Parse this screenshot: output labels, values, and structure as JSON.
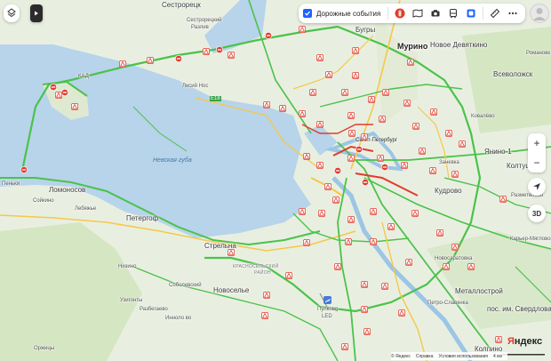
{
  "map": {
    "water_label": "Невская губа",
    "labels": {
      "sestroretsk": "Сестрорецк",
      "sestro_razliv": "Сестрорецкий",
      "razliv": "Разлив",
      "bugry": "Бугры",
      "murino": "Мурино",
      "novoe_devyatkino": "Новое Девяткино",
      "romanovka": "Романовк",
      "vsevolozhsk": "Всеволожск",
      "lisiy_nos": "Лисий Нос",
      "kovalevo": "Ковалёво",
      "yanino": "Янино-1",
      "koltushi": "Колтуш",
      "zanevka": "Заневка",
      "kudrovo": "Кудрово",
      "razmetelevo": "Разметелево",
      "karer": "Карьер-Мяглово",
      "lomonosov": "Ломоносов",
      "peterhof": "Петергоф",
      "strelna": "Стрельна",
      "penki": "Пеньки",
      "soykino": "Сойкино",
      "lebyazhye": "Лебяжье",
      "nizino": "Низино",
      "uzigonty": "Узигонты",
      "razbegaevo": "Разбегаево",
      "innolovo": "Инноло во",
      "orzhitsy": "Оржицы",
      "sobolevsky": "Соболевский",
      "novoselye": "Новоселье",
      "novosaratovka": "Новосаратовка",
      "metallostroy": "Металлострой",
      "petro_slavyanka": "Петро-Славянка",
      "sverdlova": "пос. им. Свердлова",
      "kolpino": "Колпино",
      "pulkovo": "Пулково",
      "led": "LED",
      "krasnoselsky": "КРАСНОСЕЛЬСКИЙ",
      "rayon": "РАЙОН",
      "road_e18": "E18",
      "kad": "КАД",
      "sankt": "Санкт-Петербург"
    }
  },
  "left_controls": {
    "layers_icon": "layers-icon",
    "expand_icon": "play-icon"
  },
  "toolbar": {
    "checkbox_checked": true,
    "traffic_events_label": "Дорожные события",
    "icons": [
      "traffic-icon",
      "panorama-icon",
      "camera-icon",
      "transit-icon",
      "layers-square-icon",
      "ruler-icon",
      "more-icon"
    ]
  },
  "zoom": {
    "plus": "+",
    "minus": "−"
  },
  "right_controls": {
    "compass_icon": "navigation-arrow-icon",
    "mode_3d": "3D"
  },
  "brand": "Яндекс",
  "footer": {
    "copyright": "© Яндекс",
    "help": "Справка",
    "terms": "Условия использования",
    "scale": "4 км"
  },
  "colors": {
    "water": "#b7d4ea",
    "land": "#e9efe0",
    "forest": "#cfe3bb",
    "traffic_green": "#4bc24b",
    "traffic_yellow": "#f5c84a",
    "traffic_red": "#e23b2e",
    "accent": "#1e63ff"
  }
}
